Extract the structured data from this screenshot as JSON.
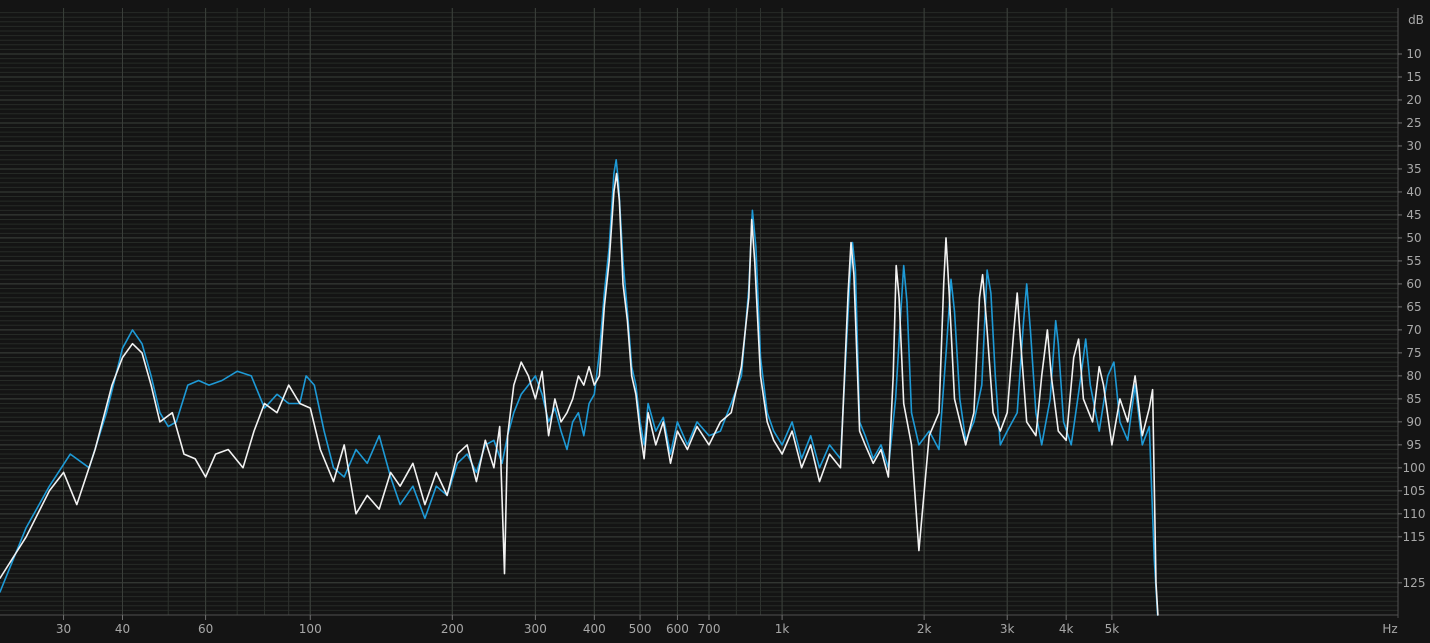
{
  "chart_data": {
    "type": "line",
    "xlabel": "Hz",
    "ylabel": "dB",
    "x_scale": "log",
    "xlim": [
      22,
      20200
    ],
    "ylim": [
      0,
      -132
    ],
    "grid": true,
    "x_ticks": [
      {
        "value": 30,
        "label": "30"
      },
      {
        "value": 40,
        "label": "40"
      },
      {
        "value": 60,
        "label": "60"
      },
      {
        "value": 100,
        "label": "100"
      },
      {
        "value": 200,
        "label": "200"
      },
      {
        "value": 300,
        "label": "300"
      },
      {
        "value": 400,
        "label": "400"
      },
      {
        "value": 500,
        "label": "500"
      },
      {
        "value": 600,
        "label": "600"
      },
      {
        "value": 700,
        "label": "700"
      },
      {
        "value": 1000,
        "label": "1k"
      },
      {
        "value": 2000,
        "label": "2k"
      },
      {
        "value": 3000,
        "label": "3k"
      },
      {
        "value": 4000,
        "label": "4k"
      },
      {
        "value": 5000,
        "label": "5k"
      }
    ],
    "y_ticks": [
      -10,
      -15,
      -20,
      -25,
      -30,
      -35,
      -40,
      -45,
      -50,
      -55,
      -60,
      -65,
      -70,
      -75,
      -80,
      -85,
      -90,
      -95,
      -100,
      -105,
      -110,
      -115,
      -125
    ],
    "y_tick_labels": [
      "10",
      "15",
      "20",
      "25",
      "30",
      "35",
      "40",
      "45",
      "50",
      "55",
      "60",
      "65",
      "70",
      "75",
      "80",
      "85",
      "90",
      "95",
      "100",
      "105",
      "110",
      "115",
      "125"
    ],
    "colors": {
      "background": "#141414",
      "grid": "#3a3f3a",
      "labels": "#a8a8a8",
      "series_blue": "#1e9ad6",
      "series_white": "#f2f2f2"
    },
    "series": [
      {
        "color": "#1e9ad6",
        "points": [
          [
            22,
            -127
          ],
          [
            25,
            -113
          ],
          [
            28,
            -104
          ],
          [
            31,
            -97
          ],
          [
            34,
            -100
          ],
          [
            37,
            -88
          ],
          [
            40,
            -74
          ],
          [
            42,
            -70
          ],
          [
            44,
            -73
          ],
          [
            46,
            -80
          ],
          [
            48,
            -88
          ],
          [
            50,
            -91
          ],
          [
            52,
            -90
          ],
          [
            55,
            -82
          ],
          [
            58,
            -81
          ],
          [
            61,
            -82
          ],
          [
            65,
            -81
          ],
          [
            70,
            -79
          ],
          [
            75,
            -80
          ],
          [
            80,
            -87
          ],
          [
            85,
            -84
          ],
          [
            90,
            -86
          ],
          [
            95,
            -86
          ],
          [
            98,
            -80
          ],
          [
            102,
            -82
          ],
          [
            107,
            -92
          ],
          [
            112,
            -100
          ],
          [
            118,
            -102
          ],
          [
            125,
            -96
          ],
          [
            132,
            -99
          ],
          [
            140,
            -93
          ],
          [
            148,
            -102
          ],
          [
            155,
            -108
          ],
          [
            165,
            -104
          ],
          [
            175,
            -111
          ],
          [
            185,
            -104
          ],
          [
            195,
            -106
          ],
          [
            205,
            -99
          ],
          [
            215,
            -97
          ],
          [
            225,
            -101
          ],
          [
            235,
            -95
          ],
          [
            245,
            -94
          ],
          [
            255,
            -99
          ],
          [
            262,
            -93
          ],
          [
            270,
            -88
          ],
          [
            280,
            -84
          ],
          [
            290,
            -82
          ],
          [
            300,
            -80
          ],
          [
            310,
            -84
          ],
          [
            320,
            -90
          ],
          [
            330,
            -87
          ],
          [
            340,
            -92
          ],
          [
            350,
            -96
          ],
          [
            360,
            -90
          ],
          [
            370,
            -88
          ],
          [
            380,
            -93
          ],
          [
            390,
            -86
          ],
          [
            400,
            -84
          ],
          [
            410,
            -75
          ],
          [
            420,
            -62
          ],
          [
            430,
            -52
          ],
          [
            440,
            -36
          ],
          [
            445,
            -33
          ],
          [
            450,
            -38
          ],
          [
            460,
            -55
          ],
          [
            470,
            -66
          ],
          [
            480,
            -78
          ],
          [
            490,
            -82
          ],
          [
            500,
            -90
          ],
          [
            510,
            -95
          ],
          [
            520,
            -86
          ],
          [
            540,
            -92
          ],
          [
            560,
            -89
          ],
          [
            580,
            -97
          ],
          [
            600,
            -90
          ],
          [
            630,
            -95
          ],
          [
            660,
            -90
          ],
          [
            700,
            -93
          ],
          [
            740,
            -92
          ],
          [
            780,
            -86
          ],
          [
            820,
            -80
          ],
          [
            850,
            -61
          ],
          [
            865,
            -44
          ],
          [
            880,
            -52
          ],
          [
            900,
            -76
          ],
          [
            930,
            -88
          ],
          [
            960,
            -92
          ],
          [
            1000,
            -95
          ],
          [
            1050,
            -90
          ],
          [
            1100,
            -98
          ],
          [
            1150,
            -93
          ],
          [
            1200,
            -100
          ],
          [
            1260,
            -95
          ],
          [
            1330,
            -98
          ],
          [
            1390,
            -60
          ],
          [
            1410,
            -51
          ],
          [
            1430,
            -57
          ],
          [
            1460,
            -90
          ],
          [
            1500,
            -93
          ],
          [
            1560,
            -98
          ],
          [
            1620,
            -95
          ],
          [
            1680,
            -100
          ],
          [
            1740,
            -85
          ],
          [
            1780,
            -68
          ],
          [
            1810,
            -56
          ],
          [
            1840,
            -64
          ],
          [
            1880,
            -88
          ],
          [
            1950,
            -95
          ],
          [
            2050,
            -92
          ],
          [
            2150,
            -96
          ],
          [
            2230,
            -74
          ],
          [
            2280,
            -59
          ],
          [
            2320,
            -66
          ],
          [
            2380,
            -85
          ],
          [
            2450,
            -94
          ],
          [
            2550,
            -90
          ],
          [
            2650,
            -82
          ],
          [
            2720,
            -57
          ],
          [
            2770,
            -62
          ],
          [
            2830,
            -80
          ],
          [
            2900,
            -95
          ],
          [
            3000,
            -92
          ],
          [
            3150,
            -88
          ],
          [
            3250,
            -68
          ],
          [
            3300,
            -60
          ],
          [
            3360,
            -70
          ],
          [
            3450,
            -88
          ],
          [
            3550,
            -95
          ],
          [
            3700,
            -85
          ],
          [
            3800,
            -68
          ],
          [
            3850,
            -73
          ],
          [
            3950,
            -90
          ],
          [
            4100,
            -95
          ],
          [
            4300,
            -80
          ],
          [
            4400,
            -72
          ],
          [
            4500,
            -82
          ],
          [
            4700,
            -92
          ],
          [
            4900,
            -80
          ],
          [
            5050,
            -77
          ],
          [
            5200,
            -90
          ],
          [
            5400,
            -94
          ],
          [
            5600,
            -82
          ],
          [
            5800,
            -95
          ],
          [
            6000,
            -91
          ],
          [
            6150,
            -120
          ],
          [
            6250,
            -132
          ]
        ]
      },
      {
        "color": "#f2f2f2",
        "points": [
          [
            22,
            -124
          ],
          [
            25,
            -115
          ],
          [
            28,
            -105
          ],
          [
            30,
            -101
          ],
          [
            32,
            -108
          ],
          [
            35,
            -96
          ],
          [
            38,
            -82
          ],
          [
            40,
            -76
          ],
          [
            42,
            -73
          ],
          [
            44,
            -75
          ],
          [
            46,
            -82
          ],
          [
            48,
            -90
          ],
          [
            51,
            -88
          ],
          [
            54,
            -97
          ],
          [
            57,
            -98
          ],
          [
            60,
            -102
          ],
          [
            63,
            -97
          ],
          [
            67,
            -96
          ],
          [
            72,
            -100
          ],
          [
            76,
            -92
          ],
          [
            80,
            -86
          ],
          [
            85,
            -88
          ],
          [
            90,
            -82
          ],
          [
            95,
            -86
          ],
          [
            100,
            -87
          ],
          [
            105,
            -96
          ],
          [
            112,
            -103
          ],
          [
            118,
            -95
          ],
          [
            125,
            -110
          ],
          [
            132,
            -106
          ],
          [
            140,
            -109
          ],
          [
            148,
            -101
          ],
          [
            155,
            -104
          ],
          [
            165,
            -99
          ],
          [
            175,
            -108
          ],
          [
            185,
            -101
          ],
          [
            195,
            -106
          ],
          [
            205,
            -97
          ],
          [
            215,
            -95
          ],
          [
            225,
            -103
          ],
          [
            235,
            -94
          ],
          [
            245,
            -100
          ],
          [
            252,
            -91
          ],
          [
            258,
            -123
          ],
          [
            262,
            -93
          ],
          [
            270,
            -82
          ],
          [
            280,
            -77
          ],
          [
            290,
            -80
          ],
          [
            300,
            -85
          ],
          [
            310,
            -79
          ],
          [
            320,
            -93
          ],
          [
            330,
            -85
          ],
          [
            340,
            -90
          ],
          [
            350,
            -88
          ],
          [
            360,
            -85
          ],
          [
            370,
            -80
          ],
          [
            380,
            -82
          ],
          [
            390,
            -78
          ],
          [
            400,
            -82
          ],
          [
            410,
            -80
          ],
          [
            420,
            -65
          ],
          [
            430,
            -55
          ],
          [
            440,
            -40
          ],
          [
            446,
            -36
          ],
          [
            452,
            -42
          ],
          [
            460,
            -60
          ],
          [
            470,
            -68
          ],
          [
            480,
            -80
          ],
          [
            490,
            -84
          ],
          [
            500,
            -92
          ],
          [
            510,
            -98
          ],
          [
            520,
            -88
          ],
          [
            540,
            -95
          ],
          [
            560,
            -90
          ],
          [
            580,
            -99
          ],
          [
            600,
            -92
          ],
          [
            630,
            -96
          ],
          [
            660,
            -91
          ],
          [
            700,
            -95
          ],
          [
            740,
            -90
          ],
          [
            780,
            -88
          ],
          [
            820,
            -78
          ],
          [
            850,
            -63
          ],
          [
            862,
            -46
          ],
          [
            875,
            -55
          ],
          [
            900,
            -80
          ],
          [
            930,
            -90
          ],
          [
            960,
            -94
          ],
          [
            1000,
            -97
          ],
          [
            1050,
            -92
          ],
          [
            1100,
            -100
          ],
          [
            1150,
            -95
          ],
          [
            1200,
            -103
          ],
          [
            1260,
            -97
          ],
          [
            1330,
            -100
          ],
          [
            1380,
            -62
          ],
          [
            1400,
            -51
          ],
          [
            1420,
            -58
          ],
          [
            1460,
            -92
          ],
          [
            1500,
            -95
          ],
          [
            1560,
            -99
          ],
          [
            1620,
            -96
          ],
          [
            1680,
            -102
          ],
          [
            1720,
            -80
          ],
          [
            1745,
            -56
          ],
          [
            1770,
            -63
          ],
          [
            1810,
            -86
          ],
          [
            1880,
            -95
          ],
          [
            1950,
            -118
          ],
          [
            2050,
            -93
          ],
          [
            2150,
            -88
          ],
          [
            2200,
            -60
          ],
          [
            2225,
            -50
          ],
          [
            2260,
            -62
          ],
          [
            2320,
            -85
          ],
          [
            2450,
            -95
          ],
          [
            2550,
            -88
          ],
          [
            2620,
            -63
          ],
          [
            2660,
            -58
          ],
          [
            2710,
            -68
          ],
          [
            2800,
            -88
          ],
          [
            2900,
            -92
          ],
          [
            3000,
            -88
          ],
          [
            3100,
            -70
          ],
          [
            3150,
            -62
          ],
          [
            3200,
            -72
          ],
          [
            3300,
            -90
          ],
          [
            3450,
            -93
          ],
          [
            3550,
            -80
          ],
          [
            3650,
            -70
          ],
          [
            3720,
            -80
          ],
          [
            3850,
            -92
          ],
          [
            4000,
            -94
          ],
          [
            4150,
            -76
          ],
          [
            4250,
            -72
          ],
          [
            4350,
            -85
          ],
          [
            4550,
            -90
          ],
          [
            4700,
            -78
          ],
          [
            4800,
            -82
          ],
          [
            5000,
            -95
          ],
          [
            5200,
            -85
          ],
          [
            5400,
            -90
          ],
          [
            5600,
            -80
          ],
          [
            5800,
            -93
          ],
          [
            6000,
            -87
          ],
          [
            6100,
            -83
          ],
          [
            6200,
            -125
          ],
          [
            6260,
            -132
          ]
        ]
      }
    ]
  }
}
